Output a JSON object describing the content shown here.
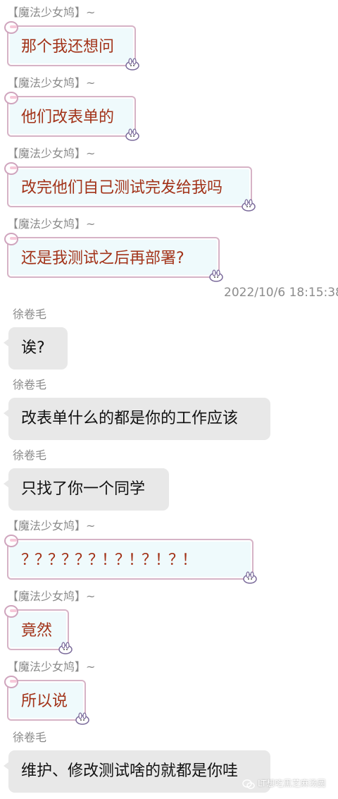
{
  "messages": [
    {
      "sender": "【魔法少女鸠】~",
      "text": "那个我还想问",
      "side": "me"
    },
    {
      "sender": "【魔法少女鸠】~",
      "text": "他们改表单的",
      "side": "me"
    },
    {
      "sender": "【魔法少女鸠】~",
      "text": "改完他们自己测试完发给我吗",
      "side": "me"
    },
    {
      "sender": "【魔法少女鸠】~",
      "text": "还是我测试之后再部署?",
      "side": "me"
    },
    {
      "sender": "徐卷毛",
      "text": "诶?",
      "side": "them"
    },
    {
      "sender": "徐卷毛",
      "text": "改表单什么的都是你的工作应该",
      "side": "them"
    },
    {
      "sender": "徐卷毛",
      "text": "只找了你一个同学",
      "side": "them"
    },
    {
      "sender": "【魔法少女鸠】~",
      "text": "？？？？？？！？！？！？！",
      "side": "me"
    },
    {
      "sender": "【魔法少女鸠】~",
      "text": "竟然",
      "side": "me"
    },
    {
      "sender": "【魔法少女鸠】~",
      "text": "所以说",
      "side": "me"
    },
    {
      "sender": "徐卷毛",
      "text": "维护、修改测试啥的就都是你哇",
      "side": "them"
    }
  ],
  "timestamp": "2022/10/6 18:15:38",
  "watermark": "LT想吃黑芝麻汤圆",
  "colors": {
    "my_bubble_bg": "#effafc",
    "my_bubble_text": "#a23218",
    "my_bubble_border": "#d6b3c6",
    "their_bubble_bg": "#e8e8e8",
    "their_bubble_text": "#111111",
    "sender_text": "#8a8a8a"
  }
}
